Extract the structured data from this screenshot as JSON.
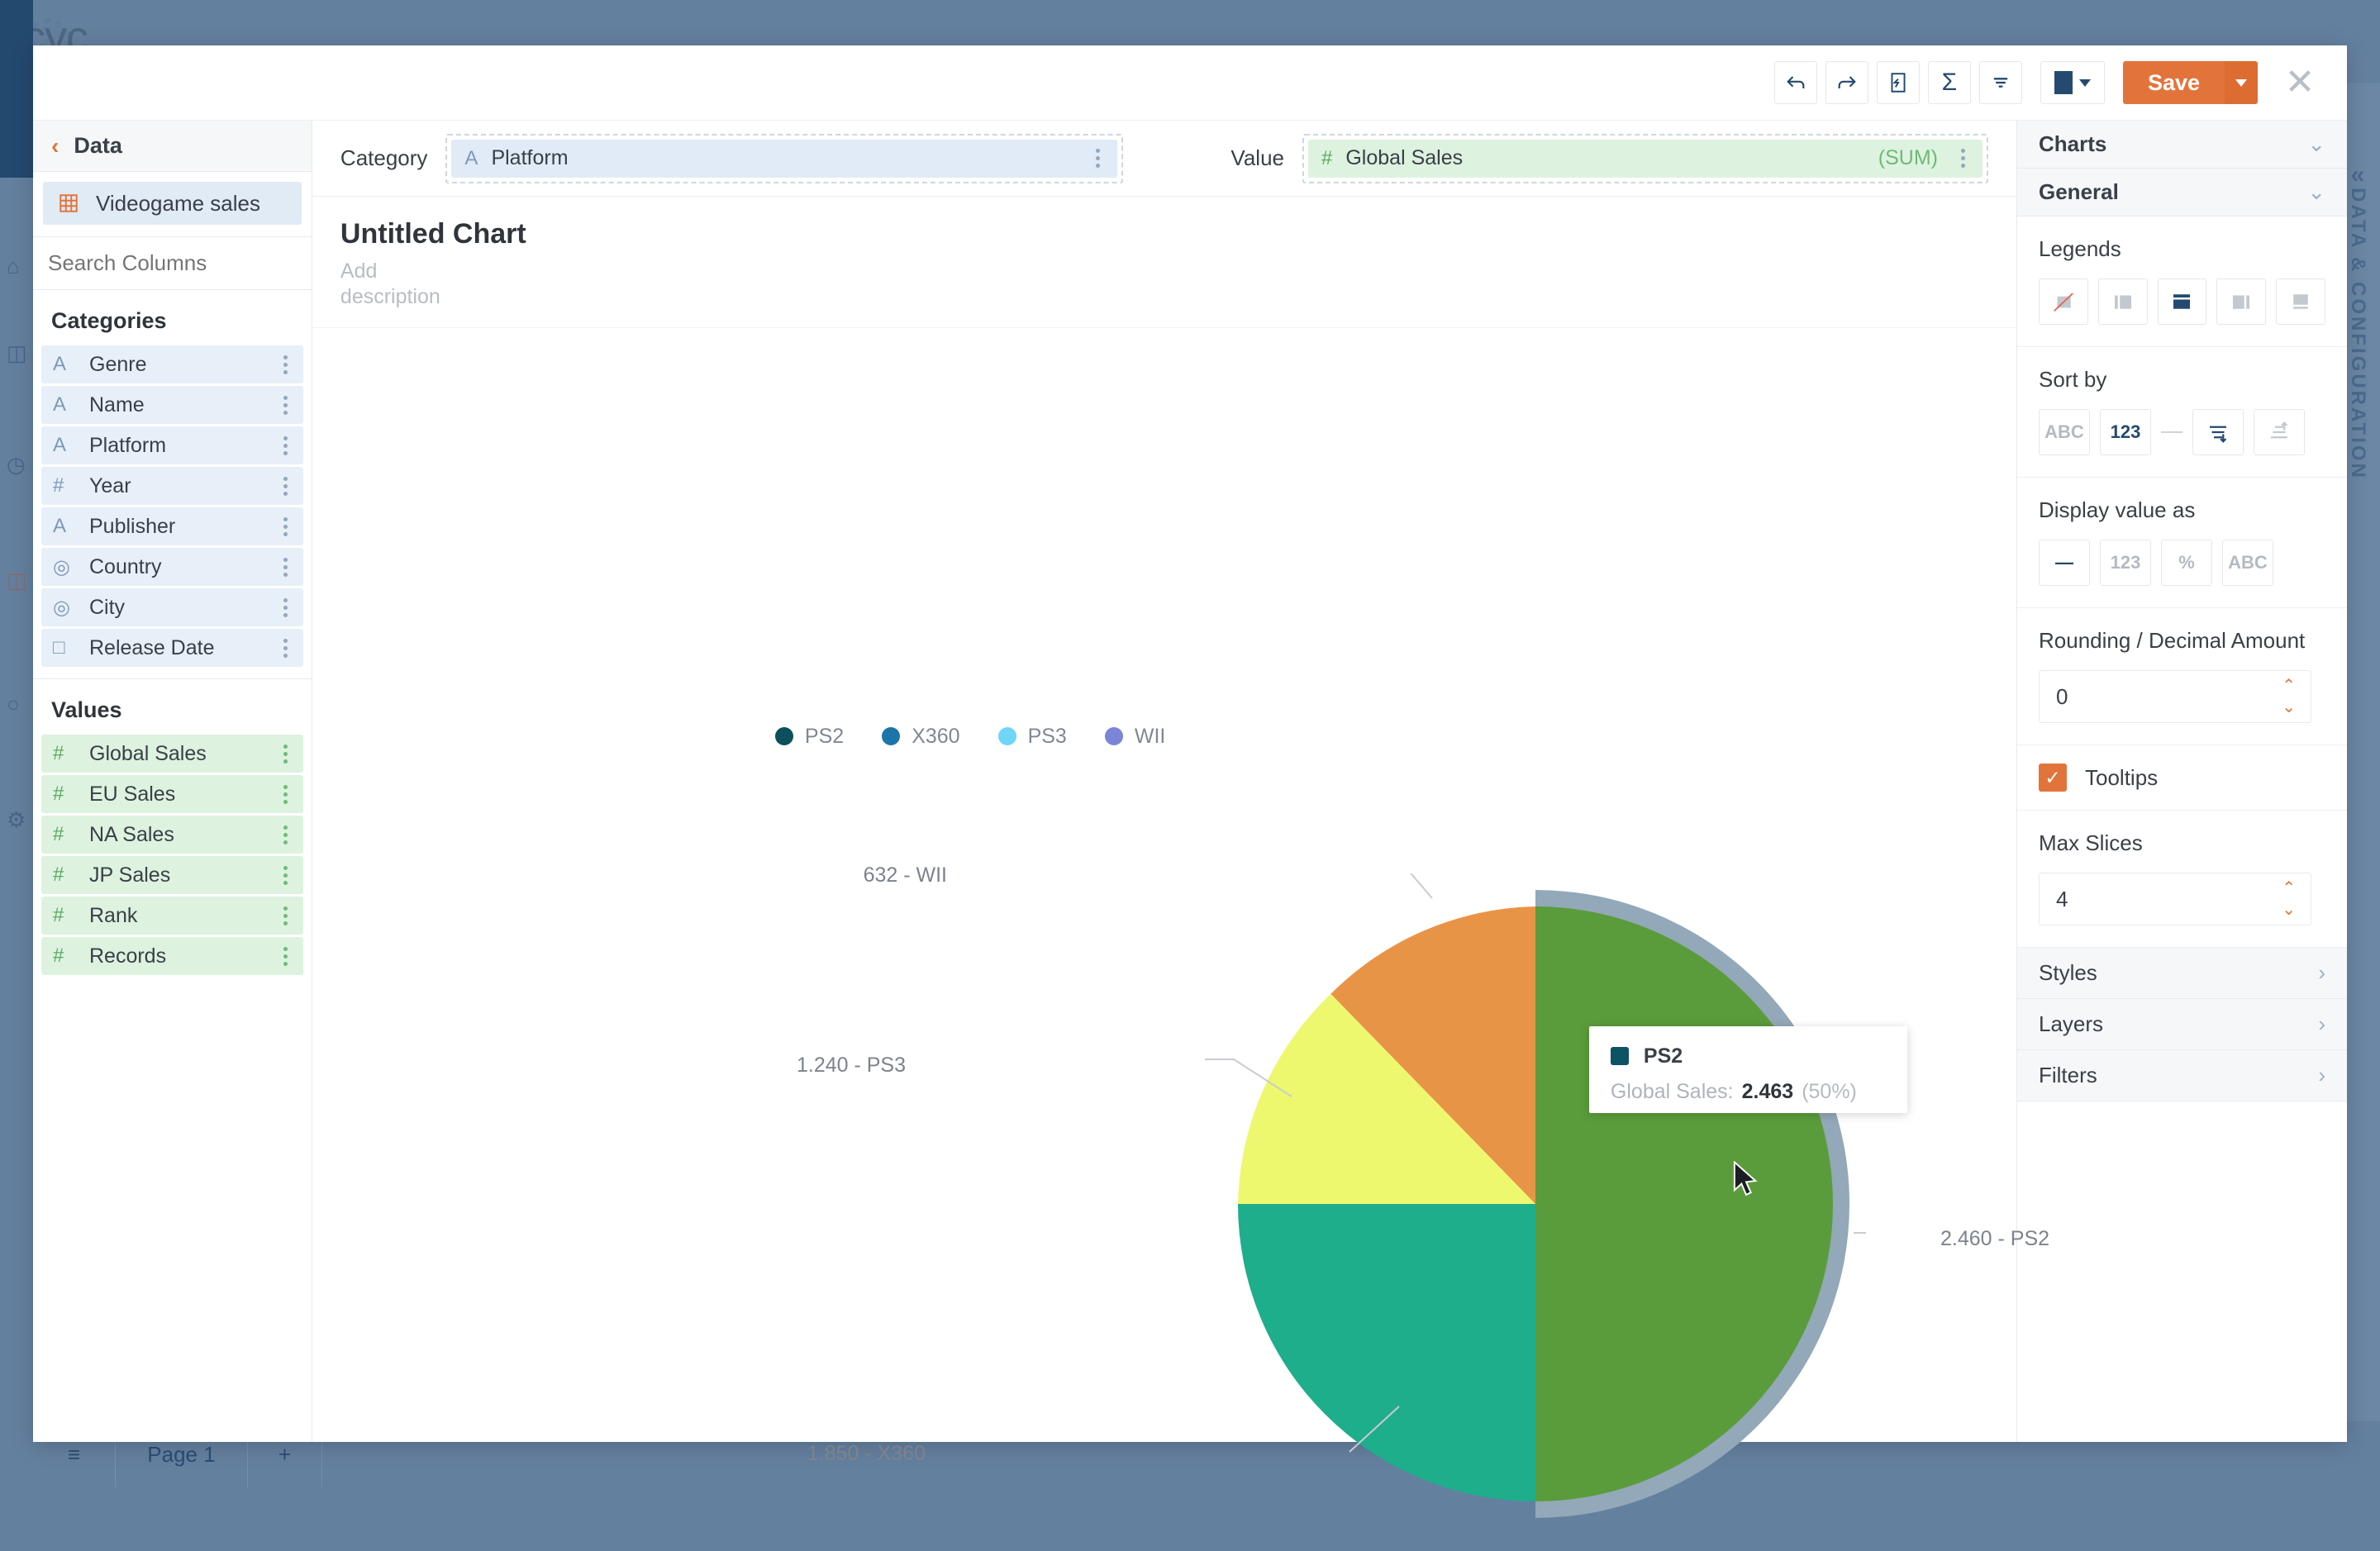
{
  "background": {
    "logo_text": "cyc.",
    "right_tab_label": "DATA & CONFIGURATION",
    "right_tab_collapse_icon": "«",
    "bottom_bar": {
      "pages_list_icon": "≡",
      "page_label": "Page 1",
      "add_page_icon": "+"
    },
    "rail_icons": [
      "home-icon",
      "table-icon",
      "clock-icon",
      "dashboard-icon",
      "comment-icon",
      "plugin-icon"
    ]
  },
  "toolbar": {
    "undo_icon": "undo-icon",
    "redo_icon": "redo-icon",
    "annotate_icon": "annotate-icon",
    "sum_icon": "Σ",
    "filter_icon": "filter-icon",
    "color_swatch": "#244a70",
    "save_label": "Save",
    "save_dropdown_icon": "chevron-down-icon",
    "close_icon": "✕"
  },
  "left_panel": {
    "header_title": "Data",
    "back_icon": "‹",
    "dataset": {
      "icon": "grid-icon",
      "label": "Videogame sales"
    },
    "search": {
      "placeholder": "Search Columns",
      "value": ""
    },
    "categories_title": "Categories",
    "categories": [
      {
        "type": "A",
        "label": "Genre"
      },
      {
        "type": "A",
        "label": "Name"
      },
      {
        "type": "A",
        "label": "Platform"
      },
      {
        "type": "#",
        "label": "Year"
      },
      {
        "type": "A",
        "label": "Publisher"
      },
      {
        "type": "◎",
        "label": "Country"
      },
      {
        "type": "◎",
        "label": "City"
      },
      {
        "type": "□",
        "label": "Release Date"
      }
    ],
    "values_title": "Values",
    "values": [
      {
        "type": "#",
        "label": "Global Sales"
      },
      {
        "type": "#",
        "label": "EU Sales"
      },
      {
        "type": "#",
        "label": "NA Sales"
      },
      {
        "type": "#",
        "label": "JP Sales"
      },
      {
        "type": "#",
        "label": "Rank"
      },
      {
        "type": "#",
        "label": "Records"
      }
    ]
  },
  "selectors": {
    "category_label": "Category",
    "category_value": "Platform",
    "category_type": "A",
    "value_label": "Value",
    "value_value": "Global Sales",
    "value_type": "#",
    "value_aggregation": "(SUM)"
  },
  "chart_header": {
    "title": "Untitled Chart",
    "description_placeholder": "Add description"
  },
  "tooltip": {
    "series": "PS2",
    "swatch": "#0d5364",
    "metric_label": "Global Sales:",
    "value": "2.463",
    "percent": "(50%)"
  },
  "right_panel": {
    "charts_section": "Charts",
    "general_section": "General",
    "legends_label": "Legends",
    "legend_options": [
      "none",
      "left",
      "top",
      "right",
      "bottom"
    ],
    "legend_selected_index": 2,
    "sort_by_label": "Sort by",
    "sort_options": [
      "ABC",
      "123"
    ],
    "sort_selected": "123",
    "sort_dir_options": [
      "descending",
      "ascending"
    ],
    "sort_dir_selected_index": 0,
    "display_value_label": "Display value as",
    "display_options": [
      "—",
      "123",
      "%",
      "ABC"
    ],
    "display_selected_index": 0,
    "rounding_label": "Rounding / Decimal Amount",
    "rounding_value": "0",
    "tooltips_label": "Tooltips",
    "tooltips_checked": true,
    "max_slices_label": "Max Slices",
    "max_slices_value": "4",
    "sub_sections": [
      "Styles",
      "Layers",
      "Filters"
    ],
    "accent_color": "#e2743b"
  },
  "chart_data": {
    "type": "pie",
    "title": "Untitled Chart",
    "categories": [
      "PS2",
      "X360",
      "PS3",
      "WII"
    ],
    "values": [
      2460,
      1850,
      1240,
      632
    ],
    "value_labels": [
      "2.460 - PS2",
      "1.850 - X360",
      "1.240 - PS3",
      "632 - WII"
    ],
    "percents": [
      50,
      25,
      16.5,
      8.5
    ],
    "slice_colors": [
      "#5a9c3b",
      "#1eae8c",
      "#eef86e",
      "#e89447"
    ],
    "legend_colors": [
      "#0d4f5c",
      "#1b75a8",
      "#6ed6f7",
      "#7b85d8"
    ],
    "hover_slice": "PS2",
    "hover_highlight_color": "#93a8b8",
    "xlabel": "",
    "ylabel": "Global Sales",
    "legend_position": "top",
    "grid": false
  }
}
